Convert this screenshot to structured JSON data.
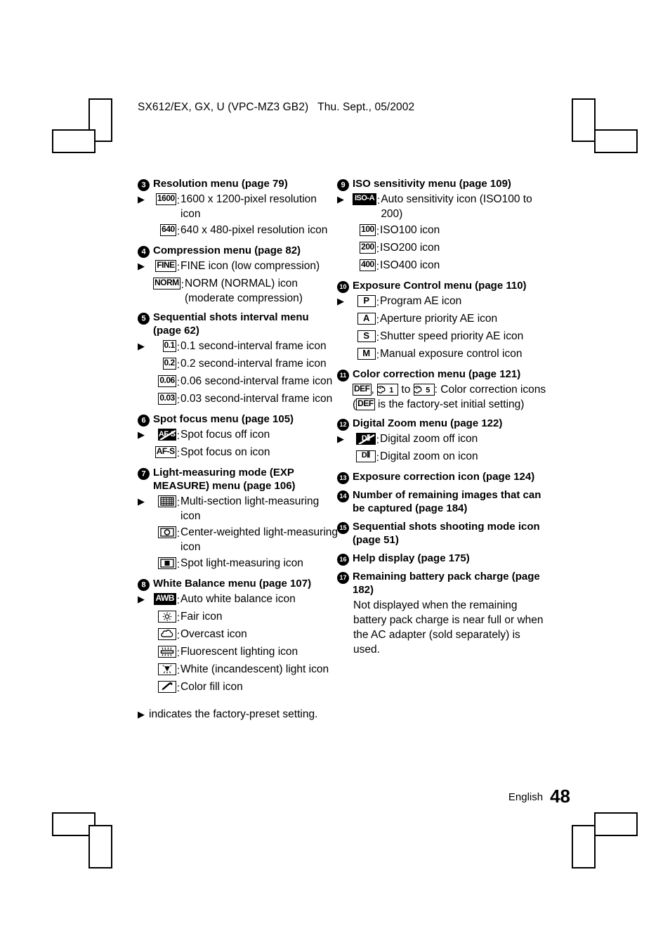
{
  "header": {
    "text": "SX612/EX, GX, U (VPC-MZ3 GB2)   Thu. Sept., 05/2002"
  },
  "footer": {
    "language": "English",
    "page_number": "48"
  },
  "note": {
    "marker": "▶",
    "text": "indicates the factory-preset setting."
  },
  "left_column": [
    {
      "number": "3",
      "title": "Resolution menu (page 79)",
      "rows": [
        {
          "arrow": true,
          "icon": "1600",
          "desc": "1600 x 1200-pixel resolution icon"
        },
        {
          "arrow": false,
          "icon": "640",
          "desc": "640 x 480-pixel resolution icon"
        }
      ]
    },
    {
      "number": "4",
      "title": "Compression menu (page 82)",
      "rows": [
        {
          "arrow": true,
          "icon": "FINE",
          "desc": "FINE icon (low compression)"
        },
        {
          "arrow": false,
          "icon": "NORM",
          "desc": "NORM (NORMAL) icon (moderate compression)"
        }
      ]
    },
    {
      "number": "5",
      "title": "Sequential shots interval menu (page 62)",
      "rows": [
        {
          "arrow": true,
          "icon": "0.1",
          "desc": "0.1 second-interval frame icon"
        },
        {
          "arrow": false,
          "icon": "0.2",
          "desc": "0.2 second-interval frame icon"
        },
        {
          "arrow": false,
          "icon": "0.06",
          "desc": "0.06 second-interval frame icon"
        },
        {
          "arrow": false,
          "icon": "0.03",
          "desc": "0.03 second-interval frame icon"
        }
      ]
    },
    {
      "number": "6",
      "title": "Spot focus menu (page 105)",
      "rows": [
        {
          "arrow": true,
          "icon": "AF-S-off",
          "desc": "Spot focus off icon"
        },
        {
          "arrow": false,
          "icon": "AF-S",
          "desc": "Spot focus on icon"
        }
      ]
    },
    {
      "number": "7",
      "title": "Light-measuring mode (EXP MEASURE) menu (page 106)",
      "rows": [
        {
          "arrow": true,
          "icon": "grid-meter",
          "desc": "Multi-section light-measuring icon"
        },
        {
          "arrow": false,
          "icon": "center-meter",
          "desc": "Center-weighted light-measuring icon"
        },
        {
          "arrow": false,
          "icon": "spot-meter",
          "desc": "Spot light-measuring icon"
        }
      ]
    },
    {
      "number": "8",
      "title": "White Balance menu (page 107)",
      "rows": [
        {
          "arrow": true,
          "icon": "AWB",
          "desc": "Auto white balance icon"
        },
        {
          "arrow": false,
          "icon": "sun",
          "desc": "Fair icon"
        },
        {
          "arrow": false,
          "icon": "cloud",
          "desc": "Overcast icon"
        },
        {
          "arrow": false,
          "icon": "fluorescent",
          "desc": "Fluorescent lighting icon"
        },
        {
          "arrow": false,
          "icon": "incandescent",
          "desc": "White (incandescent) light icon"
        },
        {
          "arrow": false,
          "icon": "eyedropper",
          "desc": "Color fill icon"
        }
      ]
    }
  ],
  "right_column": [
    {
      "number": "9",
      "title": "ISO sensitivity menu (page 109)",
      "rows": [
        {
          "arrow": true,
          "icon": "ISO-A",
          "desc": "Auto sensitivity icon (ISO100 to 200)"
        },
        {
          "arrow": false,
          "icon": "100",
          "desc": "ISO100 icon"
        },
        {
          "arrow": false,
          "icon": "200",
          "desc": "ISO200 icon"
        },
        {
          "arrow": false,
          "icon": "400",
          "desc": "ISO400 icon"
        }
      ]
    },
    {
      "number": "10",
      "title": "Exposure Control menu (page 110)",
      "rows": [
        {
          "arrow": true,
          "icon": "P",
          "desc": "Program AE icon"
        },
        {
          "arrow": false,
          "icon": "A",
          "desc": "Aperture priority AE icon"
        },
        {
          "arrow": false,
          "icon": "S",
          "desc": "Shutter speed priority AE icon"
        },
        {
          "arrow": false,
          "icon": "M",
          "desc": "Manual exposure control icon"
        }
      ]
    },
    {
      "number": "11",
      "title": "Color correction menu (page 121)",
      "paragraph_parts": {
        "def_label": "DEF",
        "comma": ",",
        "palette1": "1",
        "to": "to",
        "palette5": "5",
        "after": ": Color correction icons",
        "paren_open": "(",
        "def_label2": "DEF",
        "paren_rest": "is the factory-set initial setting)"
      }
    },
    {
      "number": "12",
      "title": "Digital Zoom menu (page 122)",
      "rows": [
        {
          "arrow": true,
          "icon": "dzoom-off",
          "desc": "Digital zoom off icon"
        },
        {
          "arrow": false,
          "icon": "dzoom-on",
          "desc": "Digital zoom on icon"
        }
      ]
    },
    {
      "number": "13",
      "title": "Exposure correction icon (page 124)"
    },
    {
      "number": "14",
      "title": "Number of remaining images that can be captured (page 184)"
    },
    {
      "number": "15",
      "title": "Sequential shots shooting mode icon (page 51)"
    },
    {
      "number": "16",
      "title": "Help display (page 175)"
    },
    {
      "number": "17",
      "title": "Remaining battery pack charge (page 182)",
      "body": "Not displayed when the remaining battery pack charge is near full or when the AC adapter (sold separately) is used."
    }
  ]
}
